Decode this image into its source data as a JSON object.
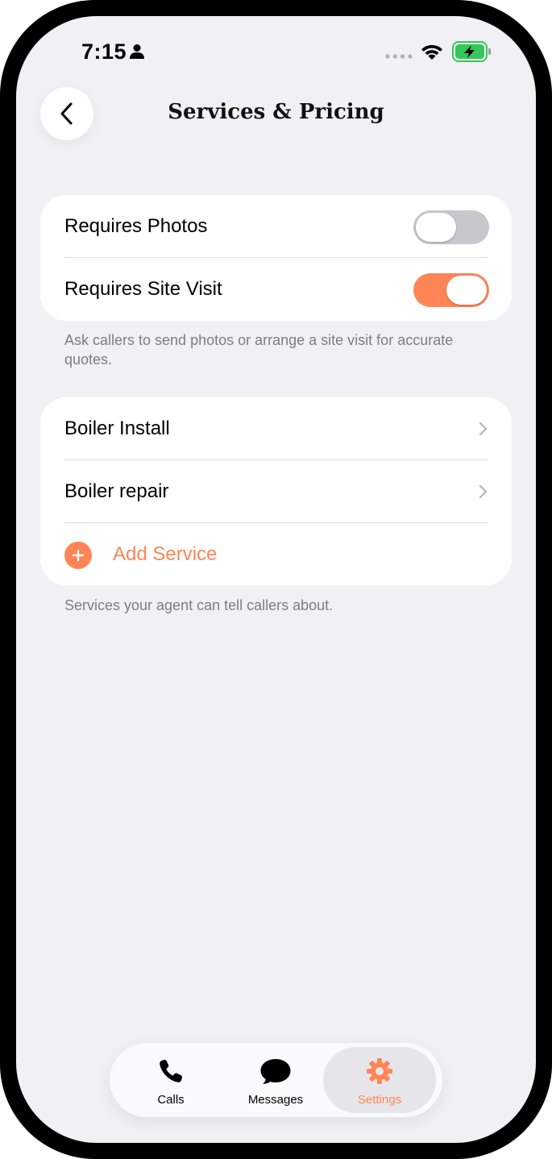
{
  "status_bar": {
    "time": "7:15"
  },
  "header": {
    "title": "Services & Pricing"
  },
  "requirements": {
    "items": [
      {
        "label": "Requires Photos",
        "enabled": false
      },
      {
        "label": "Requires Site Visit",
        "enabled": true
      }
    ],
    "footnote": "Ask callers to send photos or arrange a site visit for accurate quotes."
  },
  "services": {
    "items": [
      {
        "label": "Boiler Install"
      },
      {
        "label": "Boiler repair"
      }
    ],
    "add_label": "Add Service",
    "footnote": "Services your agent can tell callers about."
  },
  "tab_bar": {
    "tabs": [
      {
        "label": "Calls",
        "icon": "phone-icon",
        "active": false
      },
      {
        "label": "Messages",
        "icon": "chat-bubble-icon",
        "active": false
      },
      {
        "label": "Settings",
        "icon": "gear-icon",
        "active": true
      }
    ]
  },
  "colors": {
    "accent": "#ff8557",
    "background": "#f1f1f5",
    "battery_green": "#34c759"
  }
}
